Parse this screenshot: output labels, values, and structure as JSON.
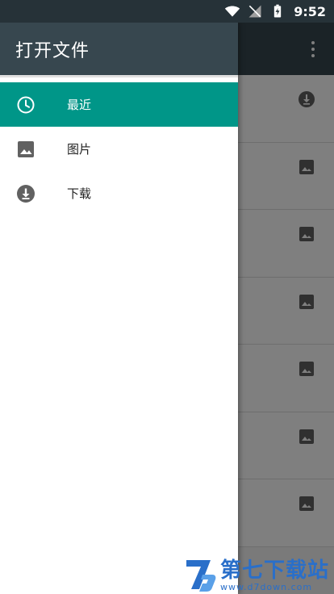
{
  "status_bar": {
    "time": "9:52",
    "icons": [
      "wifi-icon",
      "signal-off-icon",
      "battery-charging-icon"
    ]
  },
  "drawer": {
    "title": "打开文件",
    "items": [
      {
        "label": "最近",
        "icon": "clock-icon",
        "active": true
      },
      {
        "label": "图片",
        "icon": "image-icon",
        "active": false
      },
      {
        "label": "下载",
        "icon": "download-icon",
        "active": false
      }
    ]
  },
  "background_list": {
    "row_icons": [
      "download-icon",
      "image-icon",
      "image-icon",
      "image-icon",
      "image-icon",
      "image-icon",
      "image-icon"
    ]
  },
  "watermark": {
    "main": "第七下载站",
    "sub": "www.d7down.com"
  },
  "colors": {
    "status_bar": "#263238",
    "header": "#37474f",
    "accent": "#009688",
    "scrim": "rgba(0,0,0,0.5)"
  }
}
